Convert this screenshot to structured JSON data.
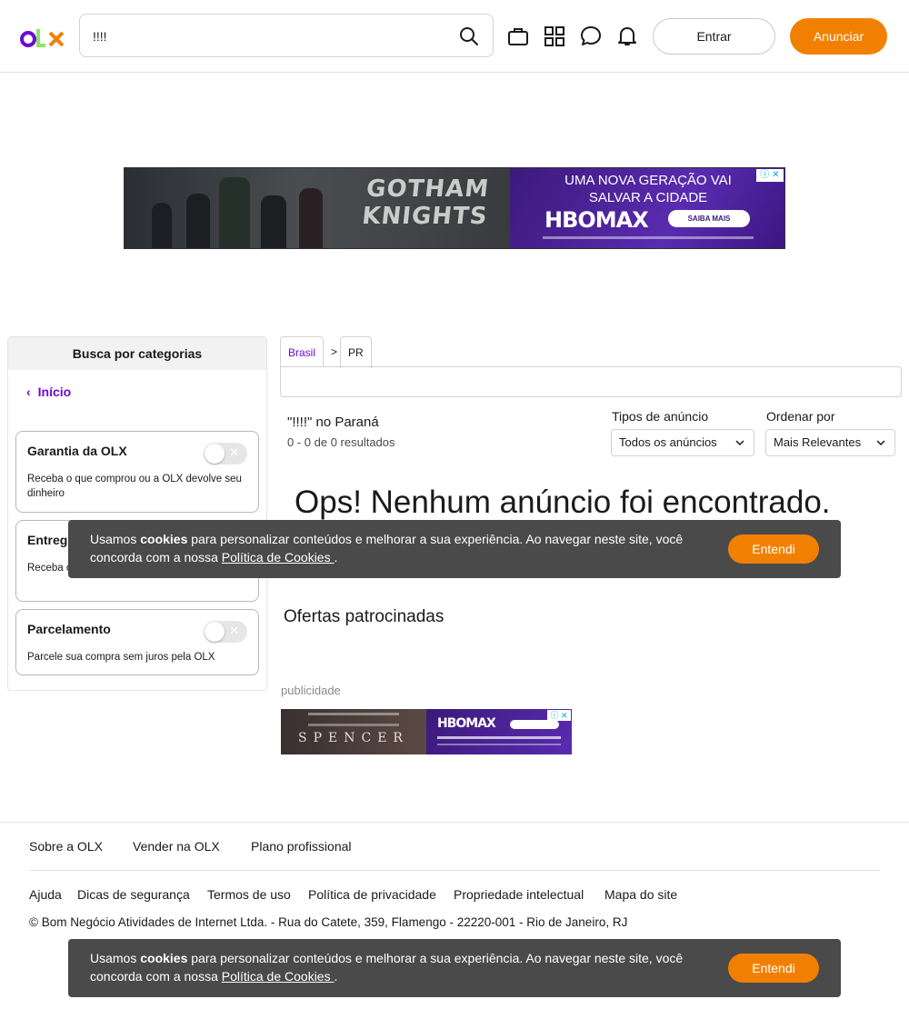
{
  "header": {
    "search_value": "!!!!",
    "entrar_label": "Entrar",
    "anunciar_label": "Anunciar",
    "icons": [
      "search-icon",
      "briefcase-icon",
      "grid-icon",
      "chat-icon",
      "bell-icon"
    ],
    "brand_colors": {
      "purple": "#6e0ad6",
      "orange": "#f28000",
      "green": "#8ce563"
    }
  },
  "top_ad": {
    "headline_line1": "UMA NOVA GERAÇÃO VAI",
    "headline_line2": "SALVAR A CIDADE",
    "brand": "HBOMAX",
    "cta": "SAIBA MAIS"
  },
  "sidebar": {
    "title": "Busca por categorias",
    "inicio_label": "Início",
    "filters": [
      {
        "title": "Garantia da OLX",
        "description": "Receba o que comprou ou a OLX devolve seu dinheiro",
        "enabled": false
      },
      {
        "title": "Entrega",
        "description": "Receba o produto em casa com segurança",
        "enabled": false
      },
      {
        "title": "Parcelamento",
        "description": "Parcele sua compra sem juros pela OLX",
        "enabled": false
      }
    ]
  },
  "breadcrumb": {
    "items": [
      "Brasil",
      "PR"
    ],
    "separator": ">"
  },
  "results": {
    "title": "\"!!!!\" no Paraná",
    "count": "0 - 0 de 0 resultados",
    "empty_message": "Ops! Nenhum anúncio foi encontrado."
  },
  "filters": {
    "tipo_label": "Tipos de anúncio",
    "tipo_value": "Todos os anúncios",
    "ordem_label": "Ordenar por",
    "ordem_value": "Mais Relevantes"
  },
  "sponsored": {
    "title": "Ofertas patrocinadas",
    "publicidade_label": "publicidade"
  },
  "bottom_ad": {
    "title": "SPENCER",
    "brand": "HBOMAX"
  },
  "footer": {
    "links_top": [
      "Sobre a OLX",
      "Vender na OLX",
      "Plano profissional"
    ],
    "links_bottom": [
      "Ajuda",
      "Dicas de segurança",
      "Termos de uso",
      "Política de privacidade",
      "Propriedade intelectual",
      "Mapa do site"
    ],
    "copyright": "© Bom Negócio Atividades de Internet Ltda. - Rua do Catete, 359, Flamengo - 22220-001 - Rio de Janeiro, RJ"
  },
  "cookie": {
    "text_prefix": "Usamos ",
    "text_bold": "cookies",
    "text_middle": " para personalizar conteúdos e melhorar a sua experiência. Ao navegar neste site, você concorda com a nossa ",
    "link": "Política de Cookies ",
    "text_suffix": ".",
    "button": "Entendi"
  }
}
